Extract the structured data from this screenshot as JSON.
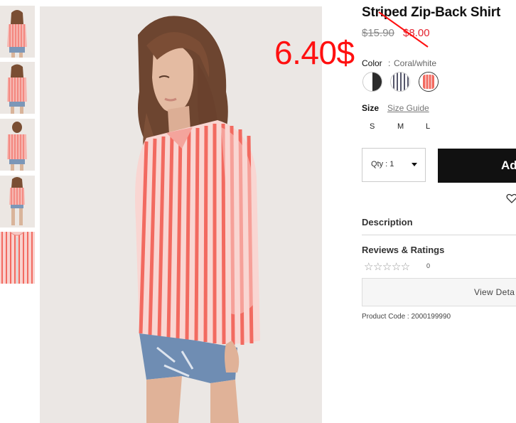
{
  "product": {
    "title": "Striped Zip-Back Shirt",
    "original_price": "$15.90",
    "sale_price": "$8.00",
    "handwritten_price": "6.40$",
    "color_label": "Color",
    "color_separator": ":",
    "color_value": "Coral/white",
    "swatches": [
      {
        "name": "black-white",
        "colors": [
          "#ffffff",
          "#2b2b2b"
        ]
      },
      {
        "name": "navy-stripe",
        "colors": [
          "#ffffff",
          "#55566a"
        ]
      },
      {
        "name": "coral-white",
        "colors": [
          "#ffffff",
          "#f26a60"
        ],
        "selected": true
      }
    ],
    "size_label": "Size",
    "size_guide": "Size Guide",
    "sizes": [
      "S",
      "M",
      "L"
    ],
    "qty_label": "Qty : 1",
    "add_button": "Ad",
    "description_label": "Description",
    "reviews_label": "Reviews & Ratings",
    "stars": "☆☆☆☆☆",
    "rating_count": "0",
    "rating_value": 0,
    "view_details": "View Deta",
    "product_code": "Product Code : 2000199990"
  },
  "colors": {
    "sale": "#e3232f",
    "annotation": "#ff1010",
    "button_bg": "#111111",
    "stripe": "#f26a60"
  }
}
